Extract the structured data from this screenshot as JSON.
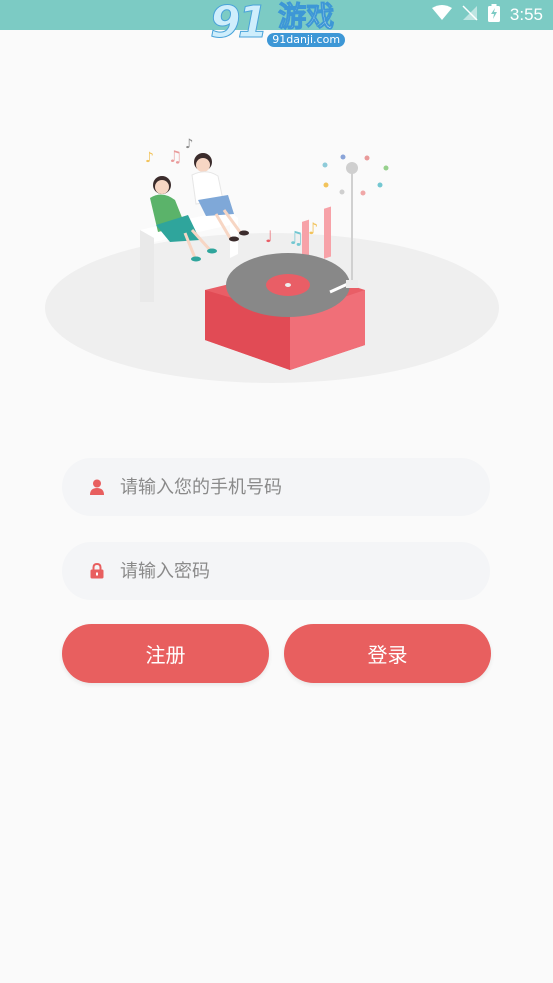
{
  "status_bar": {
    "time": "3:55",
    "watermark_number": "91",
    "watermark_text": "游戏",
    "watermark_domain": "91danji.com",
    "background_color": "#7ccbc4"
  },
  "illustration": {
    "icon": "music-listening-illustration"
  },
  "form": {
    "phone": {
      "placeholder": "请输入您的手机号码",
      "icon": "user-icon"
    },
    "password": {
      "placeholder": "请输入密码",
      "icon": "lock-icon"
    }
  },
  "buttons": {
    "register_label": "注册",
    "login_label": "登录",
    "color": "#e85f5f"
  }
}
